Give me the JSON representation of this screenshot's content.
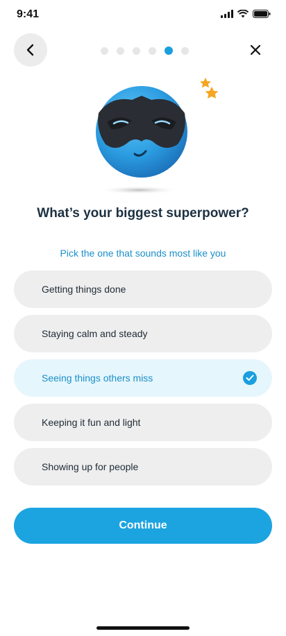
{
  "status_bar": {
    "time": "9:41"
  },
  "header": {
    "back_icon": "chevron-left-icon",
    "close_icon": "close-icon",
    "progress": {
      "total_steps": 6,
      "current_step": 5
    }
  },
  "question": {
    "title": "What’s your biggest superpower?",
    "subtitle": "Pick the one that sounds most like you"
  },
  "options": [
    {
      "label": "Getting things done",
      "selected": false
    },
    {
      "label": "Staying calm and steady",
      "selected": false
    },
    {
      "label": "Seeing things others miss",
      "selected": true
    },
    {
      "label": "Keeping it fun and light",
      "selected": false
    },
    {
      "label": "Showing up for people",
      "selected": false
    }
  ],
  "continue_label": "Continue",
  "colors": {
    "accent": "#1ca4e1",
    "selected_bg": "#e6f6fd",
    "option_bg": "#eeeeee"
  }
}
